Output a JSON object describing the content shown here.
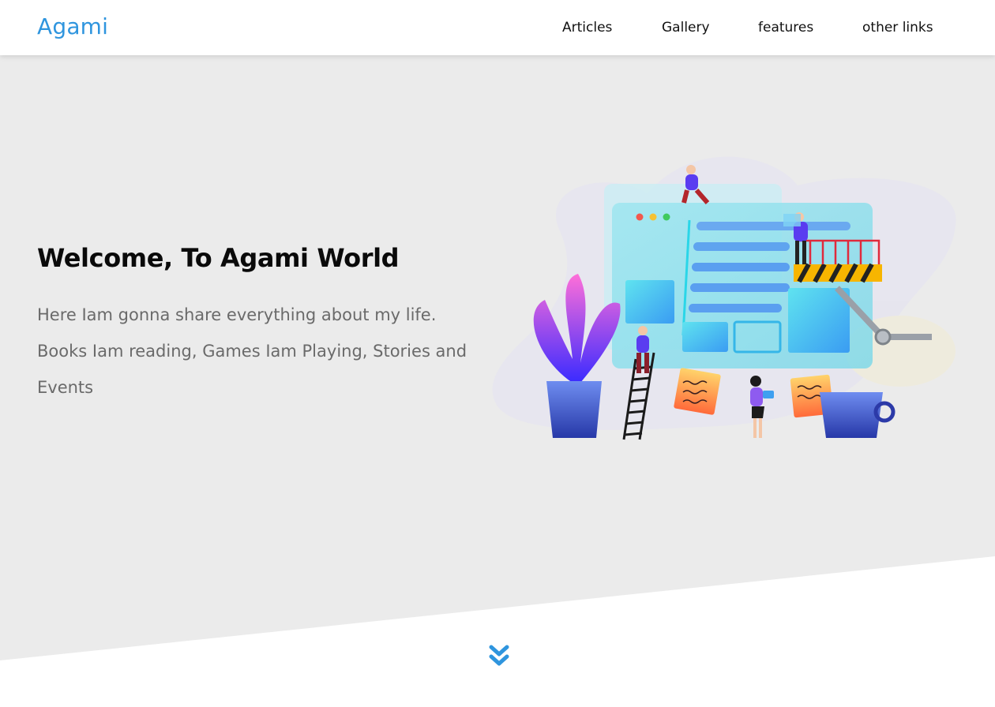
{
  "brand": {
    "name": "Agami"
  },
  "nav": {
    "items": [
      "Articles",
      "Gallery",
      "features",
      "other links"
    ]
  },
  "hero": {
    "title": "Welcome, To Agami World",
    "description": "Here Iam gonna share everything about my life. Books Iam reading, Games Iam Playing, Stories and Events"
  },
  "icons": {
    "scroll": "chevron-double-down-icon"
  },
  "colors": {
    "accent": "#2f95de",
    "hero_bg": "#ebebeb",
    "heading": "#0a0a0a",
    "body_text": "#6a6a6a"
  }
}
